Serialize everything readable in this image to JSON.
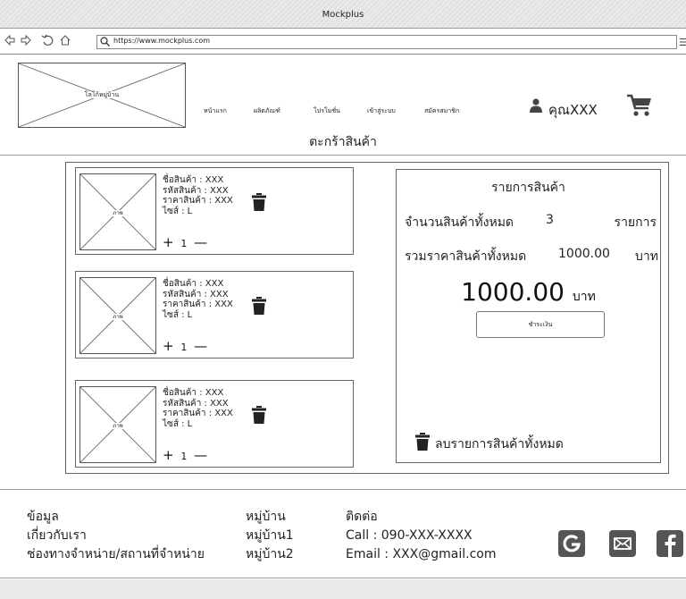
{
  "window": {
    "title": "Mockplus",
    "corner_text": ""
  },
  "browser": {
    "url": "https://www.mockplus.com"
  },
  "header": {
    "logo_text": "โลโก้หมู่บ้าน",
    "nav": [
      {
        "label": "หน้าแรก"
      },
      {
        "label": "ผลิตภัณฑ์"
      },
      {
        "label": "โปรโมชั่น"
      },
      {
        "label": "เข้าสู่ระบบ"
      },
      {
        "label": "สมัครสมาชิก"
      }
    ],
    "user_name": "คุณXXX",
    "page_title": "ตะกร้าสินค้า"
  },
  "cart": {
    "items": [
      {
        "image_label": "ภาพ",
        "name": "ชื่อสินค้า : XXX",
        "code": "รหัสสินค้า : XXX",
        "price": "ราคาสินค้า : XXX",
        "size": "ไซส์ : L",
        "plus": "+",
        "qty": "1",
        "minus": "—"
      },
      {
        "image_label": "ภาพ",
        "name": "ชื่อสินค้า : XXX",
        "code": "รหัสสินค้า : XXX",
        "price": "ราคาสินค้า : XXX",
        "size": "ไซส์ : L",
        "plus": "+",
        "qty": "1",
        "minus": "—"
      },
      {
        "image_label": "ภาพ",
        "name": "ชื่อสินค้า : XXX",
        "code": "รหัสสินค้า : XXX",
        "price": "ราคาสินค้า : XXX",
        "size": "ไซส์ : L",
        "plus": "+",
        "qty": "1",
        "minus": "—"
      }
    ]
  },
  "summary": {
    "title": "รายการสินค้า",
    "count_label": "จำนวนสินค้าทั้งหมด",
    "count_value": "3",
    "count_unit": "รายการ",
    "total_label": "รวมราคาสินค้าทั้งหมด",
    "total_value": "1000.00",
    "total_unit": "บาท",
    "big_total": "1000.00",
    "big_unit": "บาท",
    "pay_button": "ชำระเงิน",
    "clear_all": "ลบรายการสินค้าทั้งหมด"
  },
  "footer": {
    "col1": [
      "ข้อมูล",
      "เกี่ยวกับเรา",
      "ช่องทางจำหน่าย/สถานที่จำหน่าย"
    ],
    "col2": [
      "หมู่บ้าน",
      "หมู่บ้าน1",
      "หมู่บ้าน2"
    ],
    "col3": [
      "ติดต่อ",
      "Call : 090-XXX-XXXX",
      "Email : XXX@gmail.com"
    ],
    "social": [
      {
        "icon": "google-icon",
        "glyph": "G"
      },
      {
        "icon": "mail-icon",
        "glyph": "✉"
      },
      {
        "icon": "facebook-icon",
        "glyph": "f"
      }
    ]
  }
}
